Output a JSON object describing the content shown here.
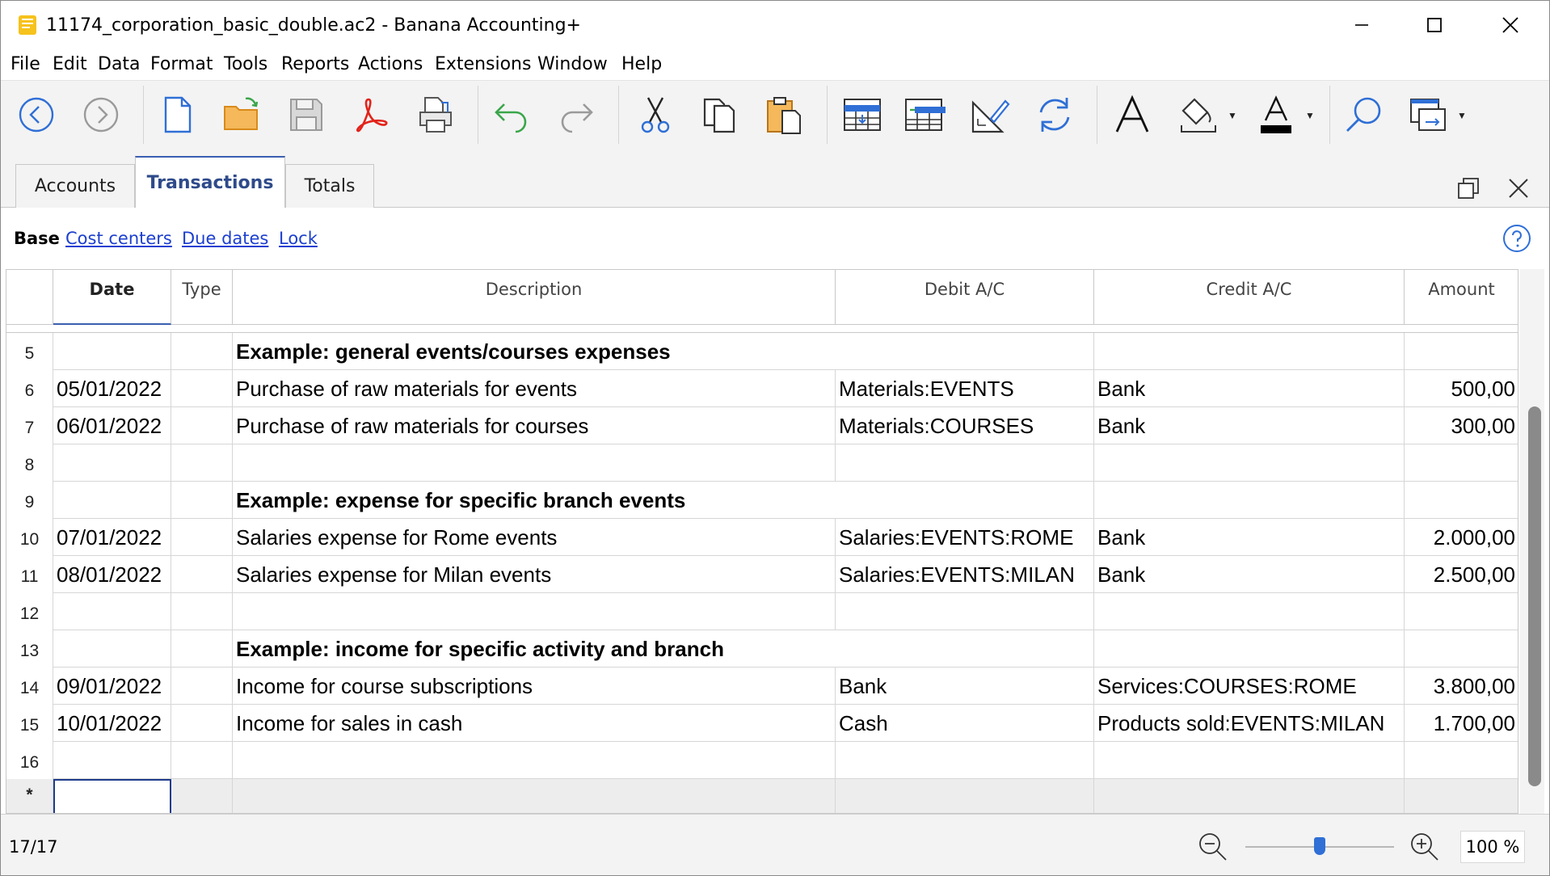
{
  "window": {
    "title": "11174_corporation_basic_double.ac2 - Banana Accounting+",
    "controls": [
      "minimize-icon",
      "maximize-icon",
      "close-icon"
    ]
  },
  "menu": [
    "File",
    "Edit",
    "Data",
    "Format",
    "Tools",
    "Reports",
    "Actions",
    "Extensions",
    "Window",
    "Help"
  ],
  "toolbar": {
    "icons": [
      "back-icon",
      "forward-icon",
      "new-file-icon",
      "open-folder-icon",
      "save-icon",
      "pdf-icon",
      "print-icon",
      "undo-icon",
      "redo-icon",
      "cut-icon",
      "copy-icon",
      "paste-icon",
      "insert-rows-icon",
      "add-rows-icon",
      "edit-row-icon",
      "recalculate-icon",
      "font-icon",
      "fill-color-icon",
      "text-color-icon",
      "search-icon",
      "open-window-icon"
    ]
  },
  "tabs": [
    "Accounts",
    "Transactions",
    "Totals"
  ],
  "active_tab": "Transactions",
  "views": {
    "current": "Base",
    "links": [
      "Cost centers",
      "Due dates",
      "Lock"
    ]
  },
  "table": {
    "columns": [
      "",
      "Date",
      "Type",
      "Description",
      "Debit A/C",
      "Credit A/C",
      "Amount"
    ],
    "rows": [
      {
        "n": "5",
        "date": "",
        "type": "",
        "desc": "Example: general events/courses expenses",
        "debit": "",
        "credit": "",
        "amount": "",
        "heading": true
      },
      {
        "n": "6",
        "date": "05/01/2022",
        "type": "",
        "desc": "Purchase of raw materials for events",
        "debit": "Materials:EVENTS",
        "credit": "Bank",
        "amount": "500,00"
      },
      {
        "n": "7",
        "date": "06/01/2022",
        "type": "",
        "desc": "Purchase of raw materials for courses",
        "debit": "Materials:COURSES",
        "credit": "Bank",
        "amount": "300,00"
      },
      {
        "n": "8",
        "date": "",
        "type": "",
        "desc": "",
        "debit": "",
        "credit": "",
        "amount": ""
      },
      {
        "n": "9",
        "date": "",
        "type": "",
        "desc": "Example: expense for specific branch events",
        "debit": "",
        "credit": "",
        "amount": "",
        "heading": true
      },
      {
        "n": "10",
        "date": "07/01/2022",
        "type": "",
        "desc": "Salaries expense for Rome events",
        "debit": "Salaries:EVENTS:ROME",
        "credit": "Bank",
        "amount": "2.000,00"
      },
      {
        "n": "11",
        "date": "08/01/2022",
        "type": "",
        "desc": "Salaries expense for Milan events",
        "debit": "Salaries:EVENTS:MILAN",
        "credit": "Bank",
        "amount": "2.500,00"
      },
      {
        "n": "12",
        "date": "",
        "type": "",
        "desc": "",
        "debit": "",
        "credit": "",
        "amount": ""
      },
      {
        "n": "13",
        "date": "",
        "type": "",
        "desc": "Example: income for specific activity and branch",
        "debit": "",
        "credit": "",
        "amount": "",
        "heading": true
      },
      {
        "n": "14",
        "date": "09/01/2022",
        "type": "",
        "desc": "Income for course subscriptions",
        "debit": "Bank",
        "credit": "Services:COURSES:ROME",
        "amount": "3.800,00"
      },
      {
        "n": "15",
        "date": "10/01/2022",
        "type": "",
        "desc": "Income for sales in cash",
        "debit": "Cash",
        "credit": "Products sold:EVENTS:MILAN",
        "amount": "1.700,00"
      },
      {
        "n": "16",
        "date": "",
        "type": "",
        "desc": "",
        "debit": "",
        "credit": "",
        "amount": ""
      }
    ],
    "new_row_marker": "*"
  },
  "status": {
    "position": "17/17",
    "zoom": "100 %",
    "zoom_level": 0.5
  },
  "colors": {
    "accent": "#3b5fb0",
    "link": "#1c3fd0",
    "toolbar_bg": "#f3f3f3"
  }
}
